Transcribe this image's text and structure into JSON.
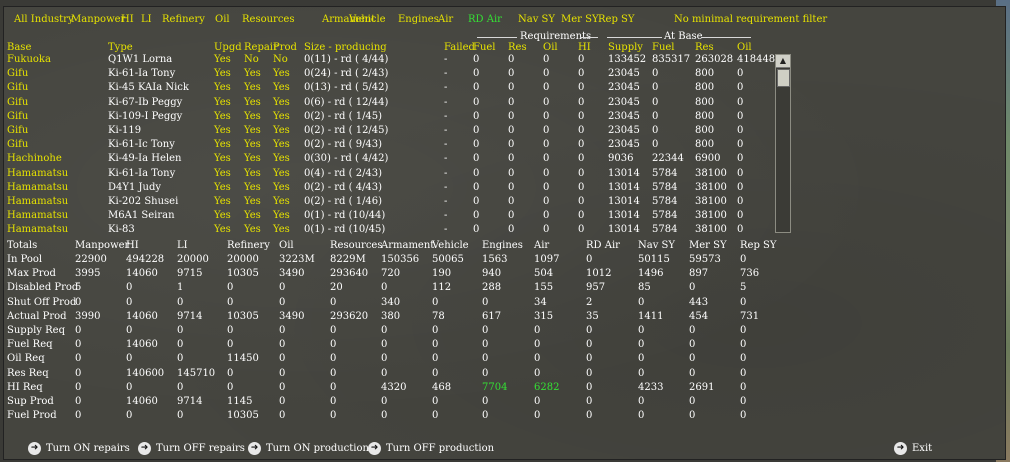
{
  "filters": [
    "All Industry",
    "Manpower",
    "HI",
    "LI",
    "Refinery",
    "Oil",
    "Resources",
    "Armament",
    "Vehicle",
    "Engines",
    "Air",
    "RD Air",
    "Nav SY",
    "Mer SY",
    "Rep SY",
    "No minimal requirement filter"
  ],
  "active_filter": "RD Air",
  "group_labels": {
    "requirements": "Requirements",
    "at_base": "At Base"
  },
  "columns": [
    "Base",
    "Type",
    "Upgd",
    "Repair",
    "Prod",
    "Size - producing",
    "Failed",
    "Fuel",
    "Res",
    "Oil",
    "HI",
    "Supply",
    "Fuel",
    "Res",
    "Oil"
  ],
  "rows": [
    [
      "Fukuoka",
      "Q1W1 Lorna",
      "Yes",
      "No",
      "No",
      "0(11) - rd ( 4/44)",
      "-",
      "0",
      "0",
      "0",
      "0",
      "133452",
      "835317",
      "263028",
      "418448"
    ],
    [
      "Gifu",
      "Ki-61-Ia Tony",
      "Yes",
      "Yes",
      "Yes",
      "0(24) - rd ( 2/43)",
      "-",
      "0",
      "0",
      "0",
      "0",
      "23045",
      "0",
      "800",
      "0"
    ],
    [
      "Gifu",
      "Ki-45 KAIa Nick",
      "Yes",
      "Yes",
      "Yes",
      "0(13) - rd ( 5/42)",
      "-",
      "0",
      "0",
      "0",
      "0",
      "23045",
      "0",
      "800",
      "0"
    ],
    [
      "Gifu",
      "Ki-67-Ib Peggy",
      "Yes",
      "Yes",
      "Yes",
      "0(6) - rd ( 12/44)",
      "-",
      "0",
      "0",
      "0",
      "0",
      "23045",
      "0",
      "800",
      "0"
    ],
    [
      "Gifu",
      "Ki-109-I Peggy",
      "Yes",
      "Yes",
      "Yes",
      "0(2) - rd ( 1/45)",
      "-",
      "0",
      "0",
      "0",
      "0",
      "23045",
      "0",
      "800",
      "0"
    ],
    [
      "Gifu",
      "Ki-119",
      "Yes",
      "Yes",
      "Yes",
      "0(2) - rd ( 12/45)",
      "-",
      "0",
      "0",
      "0",
      "0",
      "23045",
      "0",
      "800",
      "0"
    ],
    [
      "Gifu",
      "Ki-61-Ic Tony",
      "Yes",
      "Yes",
      "Yes",
      "0(2) - rd ( 9/43)",
      "-",
      "0",
      "0",
      "0",
      "0",
      "23045",
      "0",
      "800",
      "0"
    ],
    [
      "Hachinohe",
      "Ki-49-Ia Helen",
      "Yes",
      "Yes",
      "Yes",
      "0(30) - rd ( 4/42)",
      "-",
      "0",
      "0",
      "0",
      "0",
      "9036",
      "22344",
      "6900",
      "0"
    ],
    [
      "Hamamatsu",
      "Ki-61-Ia Tony",
      "Yes",
      "Yes",
      "Yes",
      "0(4) - rd ( 2/43)",
      "-",
      "0",
      "0",
      "0",
      "0",
      "13014",
      "5784",
      "38100",
      "0"
    ],
    [
      "Hamamatsu",
      "D4Y1 Judy",
      "Yes",
      "Yes",
      "Yes",
      "0(2) - rd ( 4/43)",
      "-",
      "0",
      "0",
      "0",
      "0",
      "13014",
      "5784",
      "38100",
      "0"
    ],
    [
      "Hamamatsu",
      "Ki-202 Shusei",
      "Yes",
      "Yes",
      "Yes",
      "0(2) - rd ( 1/46)",
      "-",
      "0",
      "0",
      "0",
      "0",
      "13014",
      "5784",
      "38100",
      "0"
    ],
    [
      "Hamamatsu",
      "M6A1 Seiran",
      "Yes",
      "Yes",
      "Yes",
      "0(1) - rd (10/44)",
      "-",
      "0",
      "0",
      "0",
      "0",
      "13014",
      "5784",
      "38100",
      "0"
    ],
    [
      "Hamamatsu",
      "Ki-83",
      "Yes",
      "Yes",
      "Yes",
      "0(1) - rd (10/45)",
      "-",
      "0",
      "0",
      "0",
      "0",
      "13014",
      "5784",
      "38100",
      "0"
    ]
  ],
  "totals_header": [
    "Totals",
    "Manpower",
    "HI",
    "LI",
    "Refinery",
    "Oil",
    "Resources",
    "Armament",
    "Vehicle",
    "Engines",
    "Air",
    "RD Air",
    "Nav SY",
    "Mer SY",
    "Rep SY"
  ],
  "totals_rows": [
    [
      "In Pool",
      "22900",
      "494228",
      "20000",
      "20000",
      "3223M",
      "8229M",
      "150356",
      "50065",
      "1563",
      "1097",
      "0",
      "50115",
      "59573",
      "0"
    ],
    [
      "Max Prod",
      "3995",
      "14060",
      "9715",
      "10305",
      "3490",
      "293640",
      "720",
      "190",
      "940",
      "504",
      "1012",
      "1496",
      "897",
      "736"
    ],
    [
      "Disabled Prod",
      "5",
      "0",
      "1",
      "0",
      "0",
      "20",
      "0",
      "112",
      "288",
      "155",
      "957",
      "85",
      "0",
      "5"
    ],
    [
      "Shut Off Prod",
      "0",
      "0",
      "0",
      "0",
      "0",
      "0",
      "340",
      "0",
      "0",
      "34",
      "2",
      "0",
      "443",
      "0"
    ],
    [
      "Actual Prod",
      "3990",
      "14060",
      "9714",
      "10305",
      "3490",
      "293620",
      "380",
      "78",
      "617",
      "315",
      "35",
      "1411",
      "454",
      "731"
    ],
    [
      "Supply Req",
      "0",
      "0",
      "0",
      "0",
      "0",
      "0",
      "0",
      "0",
      "0",
      "0",
      "0",
      "0",
      "0",
      "0"
    ],
    [
      "Fuel Req",
      "0",
      "14060",
      "0",
      "0",
      "0",
      "0",
      "0",
      "0",
      "0",
      "0",
      "0",
      "0",
      "0",
      "0"
    ],
    [
      "Oil Req",
      "0",
      "0",
      "0",
      "11450",
      "0",
      "0",
      "0",
      "0",
      "0",
      "0",
      "0",
      "0",
      "0",
      "0"
    ],
    [
      "Res Req",
      "0",
      "140600",
      "145710",
      "0",
      "0",
      "0",
      "0",
      "0",
      "0",
      "0",
      "0",
      "0",
      "0",
      "0"
    ],
    [
      "HI Req",
      "0",
      "0",
      "0",
      "0",
      "0",
      "0",
      "4320",
      "468",
      "7704",
      "6282",
      "0",
      "4233",
      "2691",
      "0"
    ],
    [
      "Sup Prod",
      "0",
      "14060",
      "9714",
      "1145",
      "0",
      "0",
      "0",
      "0",
      "0",
      "0",
      "0",
      "0",
      "0",
      "0"
    ],
    [
      "Fuel Prod",
      "0",
      "0",
      "0",
      "10305",
      "0",
      "0",
      "0",
      "0",
      "0",
      "0",
      "0",
      "0",
      "0",
      "0"
    ]
  ],
  "highlight_values": {
    "hi_req_engines": "7704",
    "hi_req_air": "6282"
  },
  "buttons": {
    "turn_on_repairs": "Turn ON repairs",
    "turn_off_repairs": "Turn OFF repairs",
    "turn_on_production": "Turn ON production",
    "turn_off_production": "Turn OFF production",
    "exit": "Exit"
  },
  "icons": {
    "button": "arrow-right-circle-icon",
    "scroll_up": "arrow-up-icon"
  },
  "colors": {
    "label": "#e6e200",
    "value": "#ffffff",
    "active": "#34e034",
    "panel": "#45453f"
  }
}
